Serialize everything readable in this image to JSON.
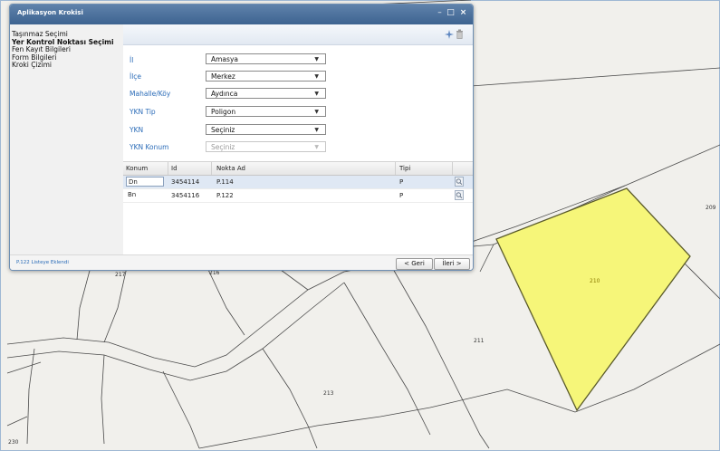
{
  "window": {
    "title": "Aplikasyon Krokisi"
  },
  "sidebar": {
    "items": [
      {
        "label": "Taşınmaz Seçimi",
        "active": false
      },
      {
        "label": "Yer Kontrol Noktası Seçimi",
        "active": true
      },
      {
        "label": "Fen Kayıt Bilgileri",
        "active": false
      },
      {
        "label": "Form Bilgileri",
        "active": false
      },
      {
        "label": "Kroki Çizimi",
        "active": false
      }
    ]
  },
  "form": {
    "fields": [
      {
        "label": "İl",
        "value": "Amasya",
        "disabled": false
      },
      {
        "label": "İlçe",
        "value": "Merkez",
        "disabled": false
      },
      {
        "label": "Mahalle/Köy",
        "value": "Aydınca",
        "disabled": false
      },
      {
        "label": "YKN Tip",
        "value": "Poligon",
        "disabled": false
      },
      {
        "label": "YKN",
        "value": "Seçiniz",
        "disabled": false
      },
      {
        "label": "YKN Konum",
        "value": "Seçiniz",
        "disabled": true
      }
    ]
  },
  "grid": {
    "columns": [
      "Konum",
      "Id",
      "Nokta Ad",
      "Tipi"
    ],
    "rows": [
      {
        "konum": "Dn",
        "id": "3454114",
        "nokta_ad": "P.114",
        "tipi": "P",
        "selected": true
      },
      {
        "konum": "Bn",
        "id": "3454116",
        "nokta_ad": "P.122",
        "tipi": "P",
        "selected": false
      }
    ]
  },
  "status": {
    "text": "P.122 Listeye Eklendi"
  },
  "buttons": {
    "back": "< Geri",
    "next": "İleri >"
  },
  "map": {
    "parcel_labels": [
      "209",
      "210",
      "211",
      "213",
      "216",
      "217",
      "230"
    ],
    "highlight_color": "#f6f679",
    "highlight_parcel": "210"
  },
  "colors": {
    "accent": "#3d6390",
    "label_blue": "#2b6cb8"
  }
}
